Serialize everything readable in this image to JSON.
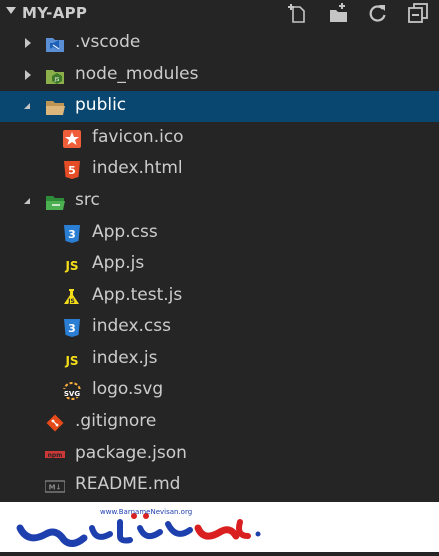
{
  "explorer": {
    "title": "MY-APP",
    "actions": [
      "new-file-icon",
      "new-folder-icon",
      "refresh-icon",
      "collapse-all-icon"
    ]
  },
  "tree": [
    {
      "label": ".vscode",
      "depth": 0,
      "type": "folder",
      "expanded": false,
      "icon": "vscode-folder-icon"
    },
    {
      "label": "node_modules",
      "depth": 0,
      "type": "folder",
      "expanded": false,
      "icon": "node-folder-icon"
    },
    {
      "label": "public",
      "depth": 0,
      "type": "folder",
      "expanded": true,
      "selected": true,
      "icon": "public-folder-icon"
    },
    {
      "label": "favicon.ico",
      "depth": 1,
      "type": "file",
      "icon": "favicon-icon"
    },
    {
      "label": "index.html",
      "depth": 1,
      "type": "file",
      "icon": "html5-icon"
    },
    {
      "label": "src",
      "depth": 0,
      "type": "folder",
      "expanded": true,
      "icon": "src-folder-icon"
    },
    {
      "label": "App.css",
      "depth": 1,
      "type": "file",
      "icon": "css3-icon"
    },
    {
      "label": "App.js",
      "depth": 1,
      "type": "file",
      "icon": "js-icon"
    },
    {
      "label": "App.test.js",
      "depth": 1,
      "type": "file",
      "icon": "test-js-icon"
    },
    {
      "label": "index.css",
      "depth": 1,
      "type": "file",
      "icon": "css3-icon"
    },
    {
      "label": "index.js",
      "depth": 1,
      "type": "file",
      "icon": "js-icon"
    },
    {
      "label": "logo.svg",
      "depth": 1,
      "type": "file",
      "icon": "svg-icon"
    },
    {
      "label": ".gitignore",
      "depth": 0,
      "type": "file",
      "icon": "git-icon"
    },
    {
      "label": "package.json",
      "depth": 0,
      "type": "file",
      "icon": "npm-icon"
    },
    {
      "label": "README.md",
      "depth": 0,
      "type": "file",
      "icon": "markdown-icon"
    }
  ],
  "watermark": {
    "url": "www.BarnameNevisan.org",
    "brand": "برنامه نویسان"
  },
  "colors": {
    "background": "#252526",
    "selection": "#094771",
    "text": "#cccccc"
  }
}
